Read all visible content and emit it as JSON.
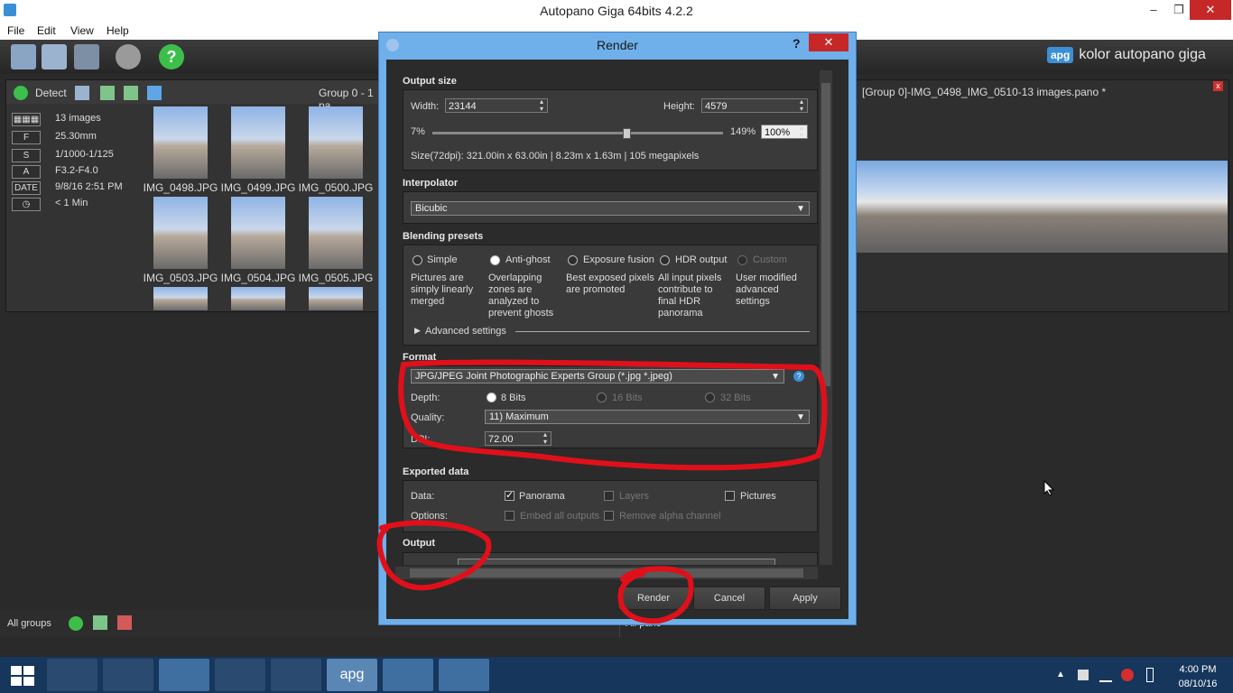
{
  "window": {
    "title": "Autopano Giga 64bits 4.2.2",
    "min": "–",
    "restore": "❐",
    "close": "✕"
  },
  "menu": [
    "File",
    "Edit",
    "View",
    "Help"
  ],
  "brand": {
    "badge": "apg",
    "text": "kolor autopano giga"
  },
  "left_panel": {
    "detect_label": "Detect",
    "group_label": "Group 0 - 1 pa",
    "info": [
      {
        "key": "▦▦▦",
        "value": "13 images"
      },
      {
        "key": "F",
        "value": "25.30mm"
      },
      {
        "key": "S",
        "value": "1/1000-1/125"
      },
      {
        "key": "A",
        "value": "F3.2-F4.0"
      },
      {
        "key": "DATE",
        "value": "9/8/16 2:51 PM"
      },
      {
        "key": "◷",
        "value": "< 1 Min"
      }
    ],
    "thumbnails": [
      "IMG_0498.JPG",
      "IMG_0499.JPG",
      "IMG_0500.JPG",
      "IMG_0503.JPG",
      "IMG_0504.JPG",
      "IMG_0505.JPG"
    ]
  },
  "right_panel": {
    "title": "[Group 0]-IMG_0498_IMG_0510-13 images.pano *",
    "close": "x"
  },
  "bottom": {
    "all_groups": "All groups",
    "all_panos": "All pano"
  },
  "dialog": {
    "title": "Render",
    "help": "?",
    "close": "✕",
    "output_size": {
      "header": "Output size",
      "width_label": "Width:",
      "width": "23144",
      "height_label": "Height:",
      "height": "4579",
      "min_pct": "7%",
      "max_pct": "149%",
      "pct": "100%",
      "scale_fraction": 0.67,
      "size_info": "Size(72dpi): 321.00in x 63.00in | 8.23m x 1.63m | 105 megapixels"
    },
    "interpolator": {
      "header": "Interpolator",
      "value": "Bicubic"
    },
    "blending": {
      "header": "Blending presets",
      "options": [
        {
          "label": "Simple",
          "desc": "Pictures are simply linearly merged",
          "selected": false,
          "enabled": true
        },
        {
          "label": "Anti-ghost",
          "desc": "Overlapping zones are analyzed to prevent ghosts",
          "selected": true,
          "enabled": true
        },
        {
          "label": "Exposure fusion",
          "desc": "Best exposed pixels are promoted",
          "selected": false,
          "enabled": true
        },
        {
          "label": "HDR output",
          "desc": "All input pixels contribute to final HDR panorama",
          "selected": false,
          "enabled": true
        },
        {
          "label": "Custom",
          "desc": "User modified advanced settings",
          "selected": false,
          "enabled": false
        }
      ],
      "advanced": "Advanced settings"
    },
    "format": {
      "header": "Format",
      "type": "JPG/JPEG Joint Photographic Experts Group (*.jpg *.jpeg)",
      "depth_label": "Depth:",
      "depth_options": [
        "8 Bits",
        "16 Bits",
        "32 Bits"
      ],
      "quality_label": "Quality:",
      "quality": "11) Maximum",
      "dpi_label": "DPI:",
      "dpi": "72.00"
    },
    "exported": {
      "header": "Exported data",
      "data_label": "Data:",
      "panorama": "Panorama",
      "layers": "Layers",
      "pictures": "Pictures",
      "options_label": "Options:",
      "embed": "Embed all outputs",
      "remove_alpha": "Remove alpha channel"
    },
    "output": {
      "header": "Output"
    },
    "buttons": {
      "render": "Render",
      "cancel": "Cancel",
      "apply": "Apply"
    }
  },
  "taskbar": {
    "time": "4:00 PM",
    "date": "08/10/16"
  },
  "colors": {
    "dialog_frame": "#6fb0ea",
    "annotation": "#e0101a",
    "taskbar": "#16365c"
  }
}
